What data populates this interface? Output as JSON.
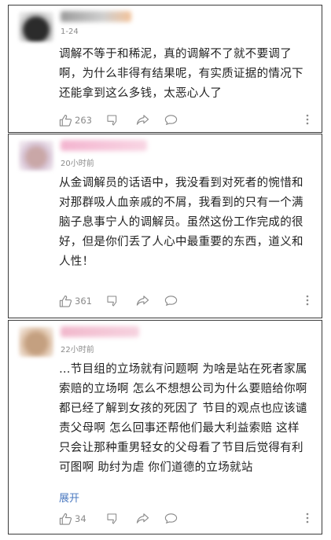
{
  "comments": [
    {
      "time": "1-24",
      "text": "调解不等于和稀泥，真的调解不了就不要调了啊，为什么非得有结果呢，有实质证据的情况下还能拿到这么多钱，太恶心人了",
      "likes": "263"
    },
    {
      "time": "20小时前",
      "text": "从金调解员的话语中，我没看到对死者的惋惜和对那群吸人血亲戚的不屑，我看到的只有一个满脑子息事宁人的调解员。虽然这份工作完成的很好，但是你们丢了人心中最重要的东西，道义和人性！",
      "likes": "361"
    },
    {
      "time": "22小时前",
      "text": "…节目组的立场就有问题啊 为啥是站在死者家属索赔的立场啊 怎么不想想公司为什么要赔给你啊 都已经了解到女孩的死因了 节目的观点也应该谴责父母啊 怎么回事还帮他们最大利益索赔 这样只会让那种重男轻女的父母看了节目后觉得有利可图啊 助纣为虐 你们道德的立场就站",
      "likes": "34",
      "expand_label": "展开"
    }
  ],
  "icons": {
    "like": "thumbs-up-icon",
    "dislike": "thumbs-down-icon",
    "share": "share-icon",
    "reply": "comment-icon",
    "more": "more-vertical-icon"
  },
  "colors": {
    "text": "#222222",
    "meta": "#8a8a8a",
    "link": "#4a78c0",
    "border": "#3a3a3a"
  }
}
